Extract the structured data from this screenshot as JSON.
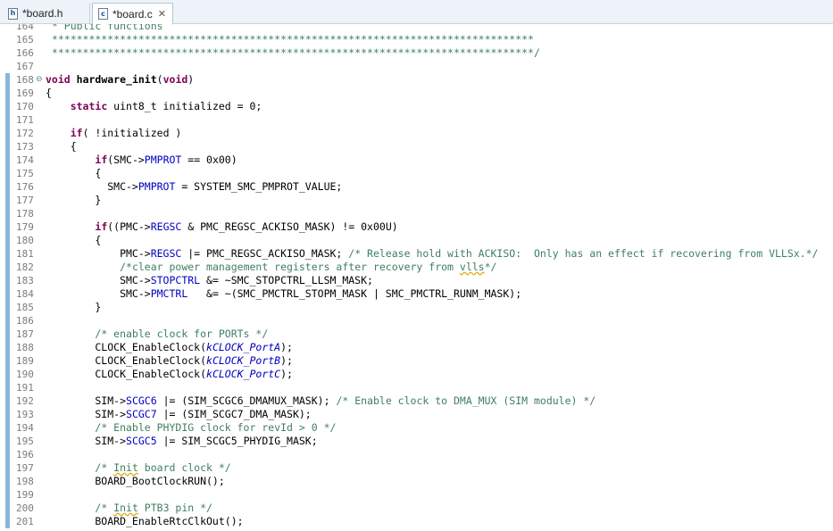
{
  "tabs": [
    {
      "label": "*board.h",
      "icon": "h",
      "active": false
    },
    {
      "label": "*board.c",
      "icon": "c",
      "active": true,
      "close": "✕"
    }
  ],
  "editor": {
    "lines": [
      {
        "n": "164",
        "marked": false,
        "fold": "",
        "segs": [
          {
            "t": " * Public functions",
            "c": "cm"
          }
        ]
      },
      {
        "n": "165",
        "marked": false,
        "fold": "",
        "segs": [
          {
            "t": " ******************************************************************************",
            "c": "cm"
          }
        ]
      },
      {
        "n": "166",
        "marked": false,
        "fold": "",
        "segs": [
          {
            "t": " ******************************************************************************/",
            "c": "cm"
          }
        ]
      },
      {
        "n": "167",
        "marked": false,
        "fold": "",
        "segs": []
      },
      {
        "n": "168",
        "marked": true,
        "fold": "⊖",
        "segs": [
          {
            "t": "void",
            "c": "kw"
          },
          {
            "t": " "
          },
          {
            "t": "hardware_init",
            "c": "fnd"
          },
          {
            "t": "("
          },
          {
            "t": "void",
            "c": "kw"
          },
          {
            "t": ")"
          }
        ]
      },
      {
        "n": "169",
        "marked": true,
        "fold": "",
        "segs": [
          {
            "t": "{"
          }
        ]
      },
      {
        "n": "170",
        "marked": true,
        "fold": "",
        "segs": [
          {
            "t": "    "
          },
          {
            "t": "static",
            "c": "kw"
          },
          {
            "t": " uint8_t initialized = 0;"
          }
        ]
      },
      {
        "n": "171",
        "marked": true,
        "fold": "",
        "segs": []
      },
      {
        "n": "172",
        "marked": true,
        "fold": "",
        "segs": [
          {
            "t": "    "
          },
          {
            "t": "if",
            "c": "kw"
          },
          {
            "t": "( !initialized )"
          }
        ]
      },
      {
        "n": "173",
        "marked": true,
        "fold": "",
        "segs": [
          {
            "t": "    {"
          }
        ]
      },
      {
        "n": "174",
        "marked": true,
        "fold": "",
        "segs": [
          {
            "t": "        "
          },
          {
            "t": "if",
            "c": "kw"
          },
          {
            "t": "(SMC->"
          },
          {
            "t": "PMPROT",
            "c": "fld"
          },
          {
            "t": " == 0x00)"
          }
        ]
      },
      {
        "n": "175",
        "marked": true,
        "fold": "",
        "segs": [
          {
            "t": "        {"
          }
        ]
      },
      {
        "n": "176",
        "marked": true,
        "fold": "",
        "segs": [
          {
            "t": "          SMC->"
          },
          {
            "t": "PMPROT",
            "c": "fld"
          },
          {
            "t": " = SYSTEM_SMC_PMPROT_VALUE;"
          }
        ]
      },
      {
        "n": "177",
        "marked": true,
        "fold": "",
        "segs": [
          {
            "t": "        }"
          }
        ]
      },
      {
        "n": "178",
        "marked": true,
        "fold": "",
        "segs": []
      },
      {
        "n": "179",
        "marked": true,
        "fold": "",
        "segs": [
          {
            "t": "        "
          },
          {
            "t": "if",
            "c": "kw"
          },
          {
            "t": "((PMC->"
          },
          {
            "t": "REGSC",
            "c": "fld"
          },
          {
            "t": " & PMC_REGSC_ACKISO_MASK) != 0x00U)"
          }
        ]
      },
      {
        "n": "180",
        "marked": true,
        "fold": "",
        "segs": [
          {
            "t": "        {"
          }
        ]
      },
      {
        "n": "181",
        "marked": true,
        "fold": "",
        "segs": [
          {
            "t": "            PMC->"
          },
          {
            "t": "REGSC",
            "c": "fld"
          },
          {
            "t": " |= PMC_REGSC_ACKISO_MASK; "
          },
          {
            "t": "/* Release hold with ACKISO:  Only has an effect if recovering from VLLSx.*/",
            "c": "cm"
          }
        ]
      },
      {
        "n": "182",
        "marked": true,
        "fold": "",
        "segs": [
          {
            "t": "            "
          },
          {
            "t": "/*clear power management registers after recovery from ",
            "c": "cm"
          },
          {
            "t": "vlls",
            "c": "cm sq"
          },
          {
            "t": "*/",
            "c": "cm"
          }
        ]
      },
      {
        "n": "183",
        "marked": true,
        "fold": "",
        "segs": [
          {
            "t": "            SMC->"
          },
          {
            "t": "STOPCTRL",
            "c": "fld"
          },
          {
            "t": " &= ~SMC_STOPCTRL_LLSM_MASK;"
          }
        ]
      },
      {
        "n": "184",
        "marked": true,
        "fold": "",
        "segs": [
          {
            "t": "            SMC->"
          },
          {
            "t": "PMCTRL",
            "c": "fld"
          },
          {
            "t": "   &= ~(SMC_PMCTRL_STOPM_MASK | SMC_PMCTRL_RUNM_MASK);"
          }
        ]
      },
      {
        "n": "185",
        "marked": true,
        "fold": "",
        "segs": [
          {
            "t": "        }"
          }
        ]
      },
      {
        "n": "186",
        "marked": true,
        "fold": "",
        "segs": []
      },
      {
        "n": "187",
        "marked": true,
        "fold": "",
        "segs": [
          {
            "t": "        "
          },
          {
            "t": "/* enable clock for PORTs */",
            "c": "cm"
          }
        ]
      },
      {
        "n": "188",
        "marked": true,
        "fold": "",
        "segs": [
          {
            "t": "        CLOCK_EnableClock("
          },
          {
            "t": "kCLOCK_PortA",
            "c": "en"
          },
          {
            "t": ");"
          }
        ]
      },
      {
        "n": "189",
        "marked": true,
        "fold": "",
        "segs": [
          {
            "t": "        CLOCK_EnableClock("
          },
          {
            "t": "kCLOCK_PortB",
            "c": "en"
          },
          {
            "t": ");"
          }
        ]
      },
      {
        "n": "190",
        "marked": true,
        "fold": "",
        "segs": [
          {
            "t": "        CLOCK_EnableClock("
          },
          {
            "t": "kCLOCK_PortC",
            "c": "en"
          },
          {
            "t": ");"
          }
        ]
      },
      {
        "n": "191",
        "marked": true,
        "fold": "",
        "segs": []
      },
      {
        "n": "192",
        "marked": true,
        "fold": "",
        "segs": [
          {
            "t": "        SIM->"
          },
          {
            "t": "SCGC6",
            "c": "fld"
          },
          {
            "t": " |= (SIM_SCGC6_DMAMUX_MASK); "
          },
          {
            "t": "/* Enable clock to DMA_MUX (SIM module) */",
            "c": "cm"
          }
        ]
      },
      {
        "n": "193",
        "marked": true,
        "fold": "",
        "segs": [
          {
            "t": "        SIM->"
          },
          {
            "t": "SCGC7",
            "c": "fld"
          },
          {
            "t": " |= (SIM_SCGC7_DMA_MASK);"
          }
        ]
      },
      {
        "n": "194",
        "marked": true,
        "fold": "",
        "segs": [
          {
            "t": "        "
          },
          {
            "t": "/* Enable PHYDIG clock for revId > 0 */",
            "c": "cm"
          }
        ]
      },
      {
        "n": "195",
        "marked": true,
        "fold": "",
        "segs": [
          {
            "t": "        SIM->"
          },
          {
            "t": "SCGC5",
            "c": "fld"
          },
          {
            "t": " |= SIM_SCGC5_PHYDIG_MASK;"
          }
        ]
      },
      {
        "n": "196",
        "marked": true,
        "fold": "",
        "segs": []
      },
      {
        "n": "197",
        "marked": true,
        "fold": "",
        "segs": [
          {
            "t": "        "
          },
          {
            "t": "/* ",
            "c": "cm"
          },
          {
            "t": "Init",
            "c": "cm sq"
          },
          {
            "t": " board clock */",
            "c": "cm"
          }
        ]
      },
      {
        "n": "198",
        "marked": true,
        "fold": "",
        "segs": [
          {
            "t": "        BOARD_BootClockRUN();"
          }
        ]
      },
      {
        "n": "199",
        "marked": true,
        "fold": "",
        "segs": []
      },
      {
        "n": "200",
        "marked": true,
        "fold": "",
        "segs": [
          {
            "t": "        "
          },
          {
            "t": "/* ",
            "c": "cm"
          },
          {
            "t": "Init",
            "c": "cm sq"
          },
          {
            "t": " PTB3 pin */",
            "c": "cm"
          }
        ]
      },
      {
        "n": "201",
        "marked": true,
        "fold": "",
        "segs": [
          {
            "t": "        BOARD_EnableRtcClkOut();"
          }
        ]
      }
    ]
  }
}
